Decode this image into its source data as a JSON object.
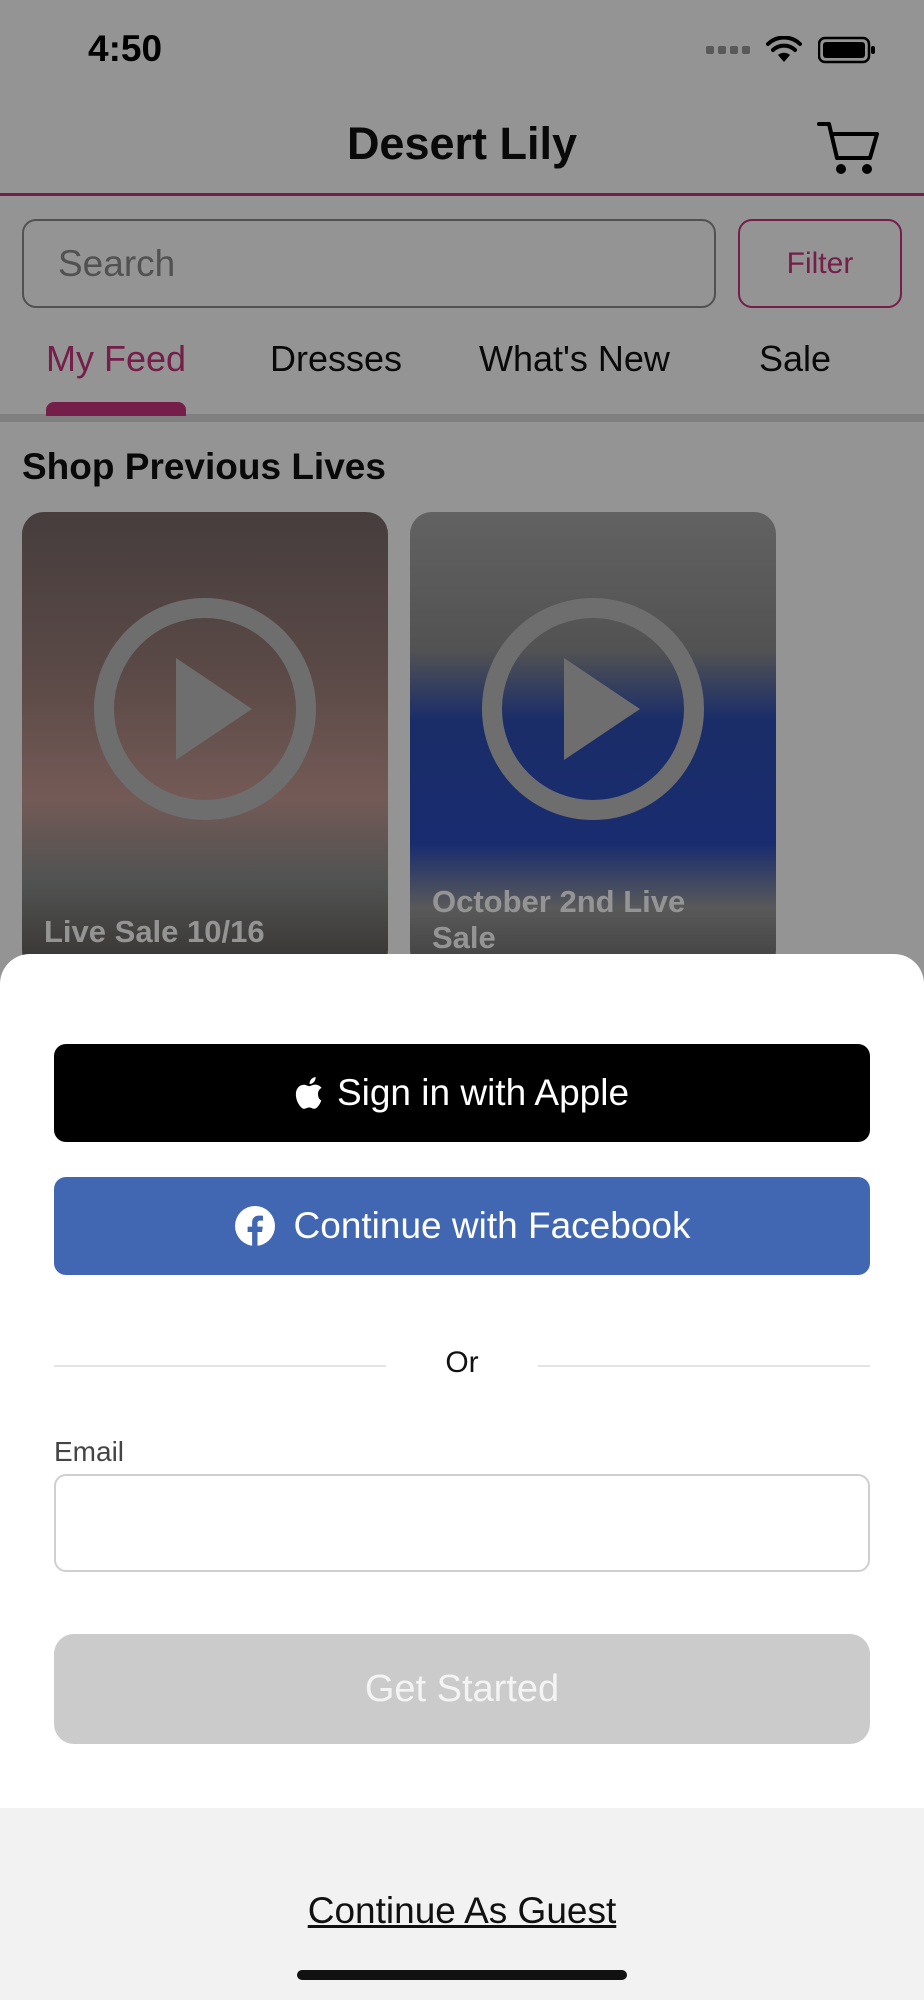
{
  "status_bar": {
    "time": "4:50"
  },
  "header": {
    "title": "Desert Lily"
  },
  "search": {
    "placeholder": "Search",
    "filter_label": "Filter"
  },
  "tabs": [
    {
      "label": "My Feed",
      "active": true
    },
    {
      "label": "Dresses",
      "active": false
    },
    {
      "label": "What's New",
      "active": false
    },
    {
      "label": "Sale",
      "active": false
    }
  ],
  "section": {
    "title": "Shop Previous Lives",
    "cards": [
      {
        "label": "Live Sale 10/16"
      },
      {
        "label_line1": "October 2nd Live",
        "label_line2": "Sale"
      }
    ]
  },
  "sheet": {
    "apple_label": "Sign in with Apple",
    "facebook_label": "Continue with Facebook",
    "or_label": "Or",
    "email_label": "Email",
    "email_value": "",
    "get_started_label": "Get Started",
    "guest_label": "Continue As Guest"
  },
  "colors": {
    "accent": "#c8357e",
    "facebook": "#4267b2",
    "apple": "#000000",
    "disabled_button": "#cbcbcb"
  },
  "icons": [
    "cart-icon",
    "wifi-icon",
    "battery-icon",
    "play-icon",
    "apple-logo-icon",
    "facebook-logo-icon"
  ]
}
